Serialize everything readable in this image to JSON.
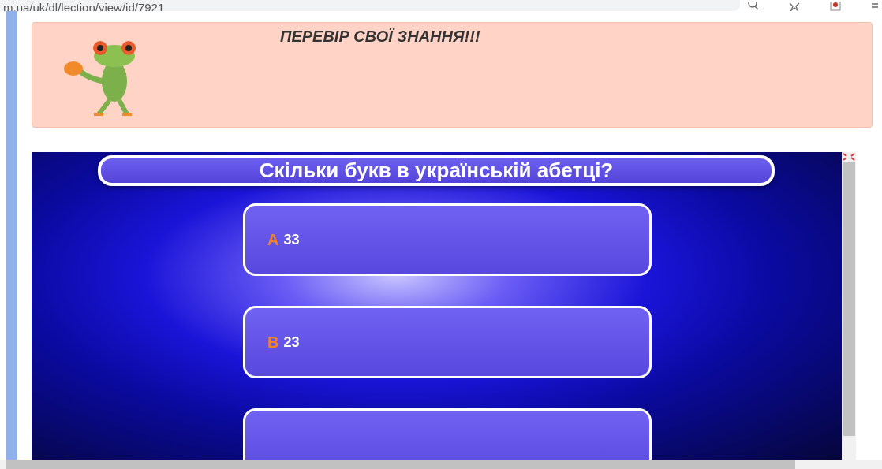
{
  "address_bar": {
    "url": "m.ua/uk/dl/lection/view/id/7921"
  },
  "banner": {
    "title": "ПЕРЕВІР СВОЇ ЗНАННЯ!!!"
  },
  "quiz": {
    "question": "Скільки букв в українській абетці?",
    "answers": [
      {
        "letter": "A",
        "text": "33"
      },
      {
        "letter": "B",
        "text": "23"
      }
    ]
  }
}
